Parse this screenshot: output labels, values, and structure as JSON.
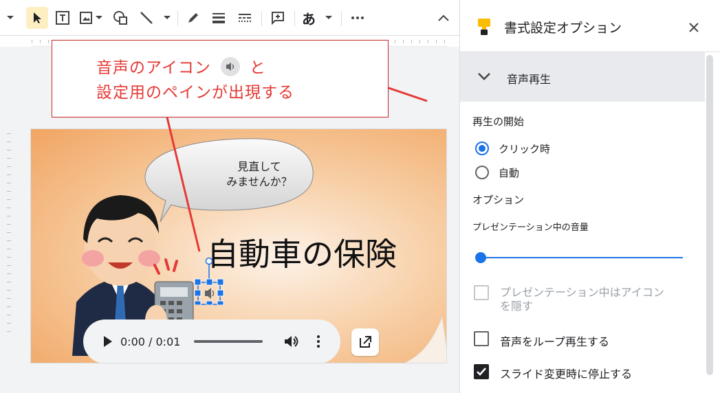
{
  "annotation": {
    "line1_prefix": "音声のアイコン",
    "line1_suffix": "と",
    "line2": "設定用のペインが出現する"
  },
  "slide": {
    "bubble_text_line1": "見直して",
    "bubble_text_line2": "みませんか？",
    "title": "自動車の保険",
    "audio_time": "0:00 / 0:01"
  },
  "panel": {
    "title": "書式設定オプション",
    "section_title": "音声再生",
    "playback_start_label": "再生の開始",
    "radio_click": "クリック時",
    "radio_auto": "自動",
    "options_label": "オプション",
    "volume_label": "プレゼンテーション中の音量",
    "volume_level": 0.0,
    "hide_icon_line1": "プレゼンテーション中はアイコン",
    "hide_icon_line2": "を隠す",
    "loop_label": "音声をループ再生する",
    "stop_label": "スライド変更時に停止する",
    "start_mode": "クリック時",
    "hide_icon_checked": false,
    "hide_icon_disabled": true,
    "loop_checked": false,
    "stop_checked": true
  },
  "colors": {
    "accent": "#1a73e8",
    "annotation_red": "#e53935",
    "brand_yellow": "#fbbc04"
  },
  "icons": [
    "chevron-down-icon",
    "select-arrow-icon",
    "text-box-icon",
    "image-icon",
    "shape-icon",
    "line-icon",
    "pen-icon",
    "line-weight-icon",
    "line-dash-icon",
    "comment-icon",
    "text-input-icon",
    "more-icon",
    "chevron-up-icon",
    "paint-format-icon",
    "close-icon",
    "play-icon",
    "volume-icon",
    "more-vert-icon",
    "open-external-icon",
    "speaker-icon"
  ],
  "toolbar": {
    "input_mode_label": "あ"
  }
}
